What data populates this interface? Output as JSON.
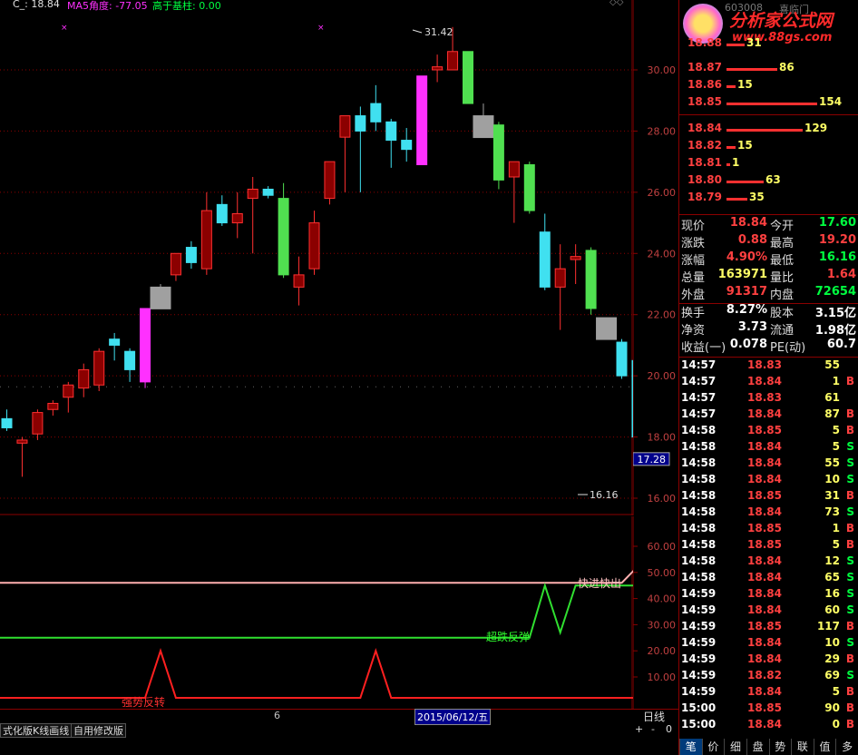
{
  "header": {
    "code_label": "C_: 18.84",
    "ma5_label": "MA5角度: -77.05",
    "gap_label": "高于基柱: 0.00",
    "stock_code": "603008",
    "stock_name": "喜临门"
  },
  "logo": {
    "text": "分析家公式网",
    "url": "www.88gs.com"
  },
  "price_axis": {
    "ticks": [
      "30.00",
      "28.00",
      "26.00",
      "24.00",
      "22.00",
      "20.00",
      "18.00",
      "16.00"
    ],
    "current_price_tag": "17.28"
  },
  "indicator_axis": {
    "ticks": [
      "60.00",
      "50.00",
      "40.00",
      "30.00",
      "20.00",
      "10.00"
    ]
  },
  "annotations": {
    "high": "31.42",
    "low": "16.16",
    "fast_in_out": "快进快出",
    "oversold_rebound": "超跌反弹",
    "strong_reversal": "强势反转"
  },
  "date_axis": {
    "month_label": "6",
    "cursor_date": "2015/06/12/五",
    "period": "日线"
  },
  "toolbar": {
    "tab1": "式化版K线画线",
    "tab2": "自用修改版",
    "plus": "+",
    "minus": "-",
    "zero": "0"
  },
  "order_book": [
    {
      "price": "18.88",
      "vol": "31"
    },
    {
      "price": "18.87",
      "vol": "86"
    },
    {
      "price": "18.86",
      "vol": "15"
    },
    {
      "price": "18.85",
      "vol": "154"
    },
    {
      "price": "18.84",
      "vol": "129"
    },
    {
      "price": "18.82",
      "vol": "15"
    },
    {
      "price": "18.81",
      "vol": "1"
    },
    {
      "price": "18.80",
      "vol": "63"
    },
    {
      "price": "18.79",
      "vol": "35"
    }
  ],
  "quote": [
    {
      "l1": "现价",
      "v1": "18.84",
      "c1": "#ff4040",
      "l2": "今开",
      "v2": "17.60",
      "c2": "#00ff40"
    },
    {
      "l1": "涨跌",
      "v1": "0.88",
      "c1": "#ff4040",
      "l2": "最高",
      "v2": "19.20",
      "c2": "#ff4040"
    },
    {
      "l1": "涨幅",
      "v1": "4.90%",
      "c1": "#ff4040",
      "l2": "最低",
      "v2": "16.16",
      "c2": "#00ff40"
    },
    {
      "l1": "总量",
      "v1": "163971",
      "c1": "#ffff66",
      "l2": "量比",
      "v2": "1.64",
      "c2": "#ff4040"
    },
    {
      "l1": "外盘",
      "v1": "91317",
      "c1": "#ff4040",
      "l2": "内盘",
      "v2": "72654",
      "c2": "#00ff40"
    },
    {
      "l1": "换手",
      "v1": "8.27%",
      "c1": "#ffffff",
      "l2": "股本",
      "v2": "3.15亿",
      "c2": "#ffffff"
    },
    {
      "l1": "净资",
      "v1": "3.73",
      "c1": "#ffffff",
      "l2": "流通",
      "v2": "1.98亿",
      "c2": "#ffffff"
    },
    {
      "l1": "收益(一)",
      "v1": "0.078",
      "c1": "#ffffff",
      "l2": "PE(动)",
      "v2": "60.7",
      "c2": "#ffffff"
    }
  ],
  "ticks": [
    {
      "t": "14:57",
      "p": "18.83",
      "v": "55",
      "s": ""
    },
    {
      "t": "14:57",
      "p": "18.84",
      "v": "1",
      "s": "B"
    },
    {
      "t": "14:57",
      "p": "18.83",
      "v": "61",
      "s": ""
    },
    {
      "t": "14:57",
      "p": "18.84",
      "v": "87",
      "s": "B"
    },
    {
      "t": "14:58",
      "p": "18.85",
      "v": "5",
      "s": "B"
    },
    {
      "t": "14:58",
      "p": "18.84",
      "v": "5",
      "s": "S"
    },
    {
      "t": "14:58",
      "p": "18.84",
      "v": "55",
      "s": "S"
    },
    {
      "t": "14:58",
      "p": "18.84",
      "v": "10",
      "s": "S"
    },
    {
      "t": "14:58",
      "p": "18.85",
      "v": "31",
      "s": "B"
    },
    {
      "t": "14:58",
      "p": "18.84",
      "v": "73",
      "s": "S"
    },
    {
      "t": "14:58",
      "p": "18.85",
      "v": "1",
      "s": "B"
    },
    {
      "t": "14:58",
      "p": "18.85",
      "v": "5",
      "s": "B"
    },
    {
      "t": "14:58",
      "p": "18.84",
      "v": "12",
      "s": "S"
    },
    {
      "t": "14:58",
      "p": "18.84",
      "v": "65",
      "s": "S"
    },
    {
      "t": "14:59",
      "p": "18.84",
      "v": "16",
      "s": "S"
    },
    {
      "t": "14:59",
      "p": "18.84",
      "v": "60",
      "s": "S"
    },
    {
      "t": "14:59",
      "p": "18.85",
      "v": "117",
      "s": "B"
    },
    {
      "t": "14:59",
      "p": "18.84",
      "v": "10",
      "s": "S"
    },
    {
      "t": "14:59",
      "p": "18.84",
      "v": "29",
      "s": "B"
    },
    {
      "t": "14:59",
      "p": "18.82",
      "v": "69",
      "s": "S"
    },
    {
      "t": "14:59",
      "p": "18.84",
      "v": "5",
      "s": "B"
    },
    {
      "t": "15:00",
      "p": "18.85",
      "v": "90",
      "s": "B"
    },
    {
      "t": "15:00",
      "p": "18.84",
      "v": "0",
      "s": "B"
    }
  ],
  "bottom_tabs": [
    "笔",
    "价",
    "细",
    "盘",
    "势",
    "联",
    "值",
    "多"
  ],
  "colors": {
    "up": "#ff3030",
    "down_cyan": "#40e0f0",
    "down_green": "#50e050",
    "magenta": "#ff30ff",
    "gray": "#a0a0a0",
    "grid": "#8b0000"
  },
  "chart_data": {
    "type": "candlestick",
    "ylim": [
      15.6,
      32.6
    ],
    "candles": [
      {
        "o": 18.6,
        "h": 18.9,
        "l": 18.2,
        "c": 18.3,
        "k": "down_cyan"
      },
      {
        "o": 17.8,
        "h": 18.0,
        "l": 16.7,
        "c": 17.9,
        "k": "up"
      },
      {
        "o": 18.1,
        "h": 18.9,
        "l": 17.9,
        "c": 18.8,
        "k": "up"
      },
      {
        "o": 18.9,
        "h": 19.2,
        "l": 18.7,
        "c": 19.1,
        "k": "up"
      },
      {
        "o": 19.3,
        "h": 19.8,
        "l": 18.8,
        "c": 19.7,
        "k": "up"
      },
      {
        "o": 19.6,
        "h": 20.4,
        "l": 19.3,
        "c": 20.2,
        "k": "up"
      },
      {
        "o": 19.7,
        "h": 20.9,
        "l": 19.5,
        "c": 20.8,
        "k": "up"
      },
      {
        "o": 21.2,
        "h": 21.4,
        "l": 20.5,
        "c": 21.0,
        "k": "down_cyan"
      },
      {
        "o": 20.8,
        "h": 20.9,
        "l": 19.8,
        "c": 20.2,
        "k": "down_cyan"
      },
      {
        "o": 19.8,
        "h": 22.2,
        "l": 19.6,
        "c": 22.2,
        "k": "magenta"
      },
      {
        "o": 22.2,
        "h": 23.0,
        "l": 22.2,
        "c": 22.9,
        "k": "gray"
      },
      {
        "o": 23.3,
        "h": 24.0,
        "l": 23.1,
        "c": 24.0,
        "k": "up"
      },
      {
        "o": 24.2,
        "h": 24.4,
        "l": 23.5,
        "c": 23.7,
        "k": "down_cyan"
      },
      {
        "o": 23.5,
        "h": 26.0,
        "l": 23.3,
        "c": 25.4,
        "k": "up"
      },
      {
        "o": 25.6,
        "h": 25.9,
        "l": 24.9,
        "c": 25.0,
        "k": "down_cyan"
      },
      {
        "o": 25.0,
        "h": 26.0,
        "l": 24.5,
        "c": 25.3,
        "k": "up"
      },
      {
        "o": 25.8,
        "h": 26.5,
        "l": 24.0,
        "c": 26.1,
        "k": "up"
      },
      {
        "o": 26.1,
        "h": 26.2,
        "l": 25.8,
        "c": 25.9,
        "k": "down_cyan"
      },
      {
        "o": 25.8,
        "h": 26.3,
        "l": 23.2,
        "c": 23.3,
        "k": "down_green"
      },
      {
        "o": 22.9,
        "h": 23.9,
        "l": 22.3,
        "c": 23.3,
        "k": "up"
      },
      {
        "o": 23.5,
        "h": 25.4,
        "l": 23.3,
        "c": 25.0,
        "k": "up"
      },
      {
        "o": 25.8,
        "h": 27.0,
        "l": 25.6,
        "c": 27.0,
        "k": "up"
      },
      {
        "o": 27.8,
        "h": 28.5,
        "l": 26.0,
        "c": 28.5,
        "k": "up"
      },
      {
        "o": 28.5,
        "h": 28.8,
        "l": 26.0,
        "c": 28.0,
        "k": "down_cyan"
      },
      {
        "o": 28.9,
        "h": 29.5,
        "l": 28.0,
        "c": 28.3,
        "k": "down_cyan"
      },
      {
        "o": 28.3,
        "h": 28.4,
        "l": 26.8,
        "c": 27.7,
        "k": "down_cyan"
      },
      {
        "o": 27.7,
        "h": 28.1,
        "l": 27.0,
        "c": 27.4,
        "k": "down_cyan"
      },
      {
        "o": 26.9,
        "h": 29.8,
        "l": 26.9,
        "c": 29.8,
        "k": "magenta"
      },
      {
        "o": 30.0,
        "h": 30.5,
        "l": 29.6,
        "c": 30.1,
        "k": "up"
      },
      {
        "o": 30.0,
        "h": 31.4,
        "l": 30.0,
        "c": 30.6,
        "k": "up"
      },
      {
        "o": 30.6,
        "h": 30.6,
        "l": 28.9,
        "c": 28.9,
        "k": "down_green"
      },
      {
        "o": 28.5,
        "h": 28.9,
        "l": 28.1,
        "c": 28.2,
        "k": "gray"
      },
      {
        "o": 28.2,
        "h": 28.3,
        "l": 26.1,
        "c": 26.4,
        "k": "down_green"
      },
      {
        "o": 26.5,
        "h": 27.0,
        "l": 25.0,
        "c": 27.0,
        "k": "up"
      },
      {
        "o": 26.9,
        "h": 27.0,
        "l": 25.3,
        "c": 25.4,
        "k": "down_green"
      },
      {
        "o": 24.7,
        "h": 25.3,
        "l": 22.8,
        "c": 22.9,
        "k": "down_cyan"
      },
      {
        "o": 22.9,
        "h": 24.3,
        "l": 21.5,
        "c": 23.5,
        "k": "up"
      },
      {
        "o": 23.8,
        "h": 24.3,
        "l": 23.0,
        "c": 23.9,
        "k": "up"
      },
      {
        "o": 24.1,
        "h": 24.2,
        "l": 22.0,
        "c": 22.2,
        "k": "down_green"
      },
      {
        "o": 21.9,
        "h": 21.9,
        "l": 21.4,
        "c": 21.3,
        "k": "gray"
      },
      {
        "o": 21.1,
        "h": 21.2,
        "l": 19.9,
        "c": 20.0,
        "k": "down_cyan"
      },
      {
        "o": 20.5,
        "h": 20.6,
        "l": 18.0,
        "c": 18.0,
        "k": "down_cyan"
      },
      {
        "o": 17.5,
        "h": 19.2,
        "l": 16.2,
        "c": 18.8,
        "k": "up"
      }
    ],
    "indicator": {
      "ylim": [
        0,
        68
      ],
      "fast_line": [
        46,
        46,
        46,
        46,
        46,
        46,
        46,
        46,
        46,
        46,
        46,
        46,
        46,
        46,
        46,
        46,
        46,
        46,
        46,
        46,
        46,
        46,
        46,
        46,
        46,
        46,
        46,
        46,
        46,
        46,
        46,
        46,
        46,
        46,
        46,
        46,
        46,
        46,
        46,
        46,
        46,
        52,
        66
      ],
      "rebound_line": [
        25,
        25,
        25,
        25,
        25,
        25,
        25,
        25,
        25,
        25,
        25,
        25,
        25,
        25,
        25,
        25,
        25,
        25,
        25,
        25,
        25,
        25,
        25,
        25,
        25,
        25,
        25,
        25,
        25,
        25,
        25,
        25,
        25,
        25,
        25,
        45,
        27,
        45,
        45,
        45,
        45,
        45,
        45
      ],
      "reversal_line": [
        2,
        2,
        2,
        2,
        2,
        2,
        2,
        2,
        2,
        2,
        20,
        2,
        2,
        2,
        2,
        2,
        2,
        2,
        2,
        2,
        2,
        2,
        2,
        2,
        20,
        2,
        2,
        2,
        2,
        2,
        2,
        2,
        2,
        2,
        2,
        2,
        2,
        2,
        2,
        2,
        2,
        2,
        2
      ]
    }
  }
}
